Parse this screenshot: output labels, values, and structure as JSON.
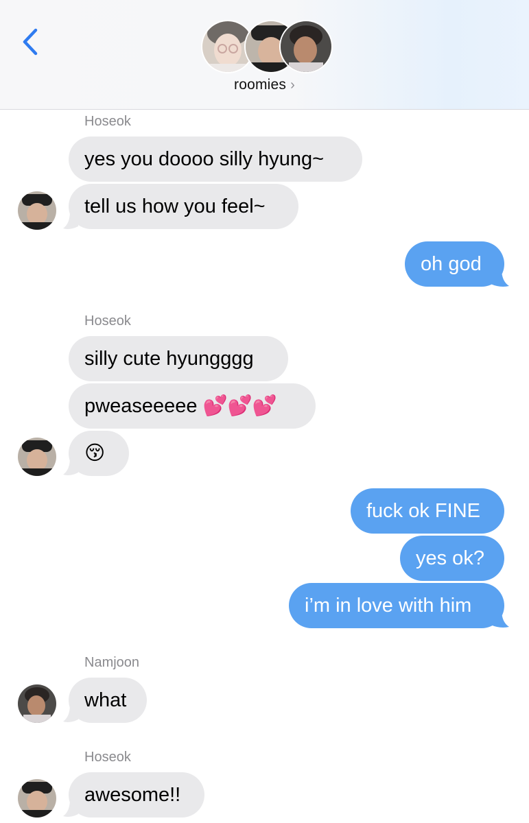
{
  "header": {
    "title": "roomies",
    "back_icon": "chevron-left-icon",
    "info_icon": "chevron-right-icon"
  },
  "colors": {
    "incoming_bubble": "#e9e9eb",
    "outgoing_bubble": "#5aa2f1",
    "accent": "#2f7bf0"
  },
  "messages": {
    "m1": {
      "sender": "Hoseok",
      "text": "yes you doooo silly hyung~"
    },
    "m2": {
      "text": "tell us how you feel~"
    },
    "m3": {
      "text": "oh god"
    },
    "m4": {
      "sender": "Hoseok",
      "text": "silly cute hyungggg"
    },
    "m5": {
      "text": "pweaseeeee 💕💕💕"
    },
    "m6": {
      "text": "😚"
    },
    "m7": {
      "text": "fuck ok FINE"
    },
    "m8": {
      "text": "yes ok?"
    },
    "m9": {
      "text": "i’m in love with him"
    },
    "m10": {
      "sender": "Namjoon",
      "text": "what"
    },
    "m11": {
      "sender": "Hoseok",
      "text": "awesome!!"
    }
  }
}
